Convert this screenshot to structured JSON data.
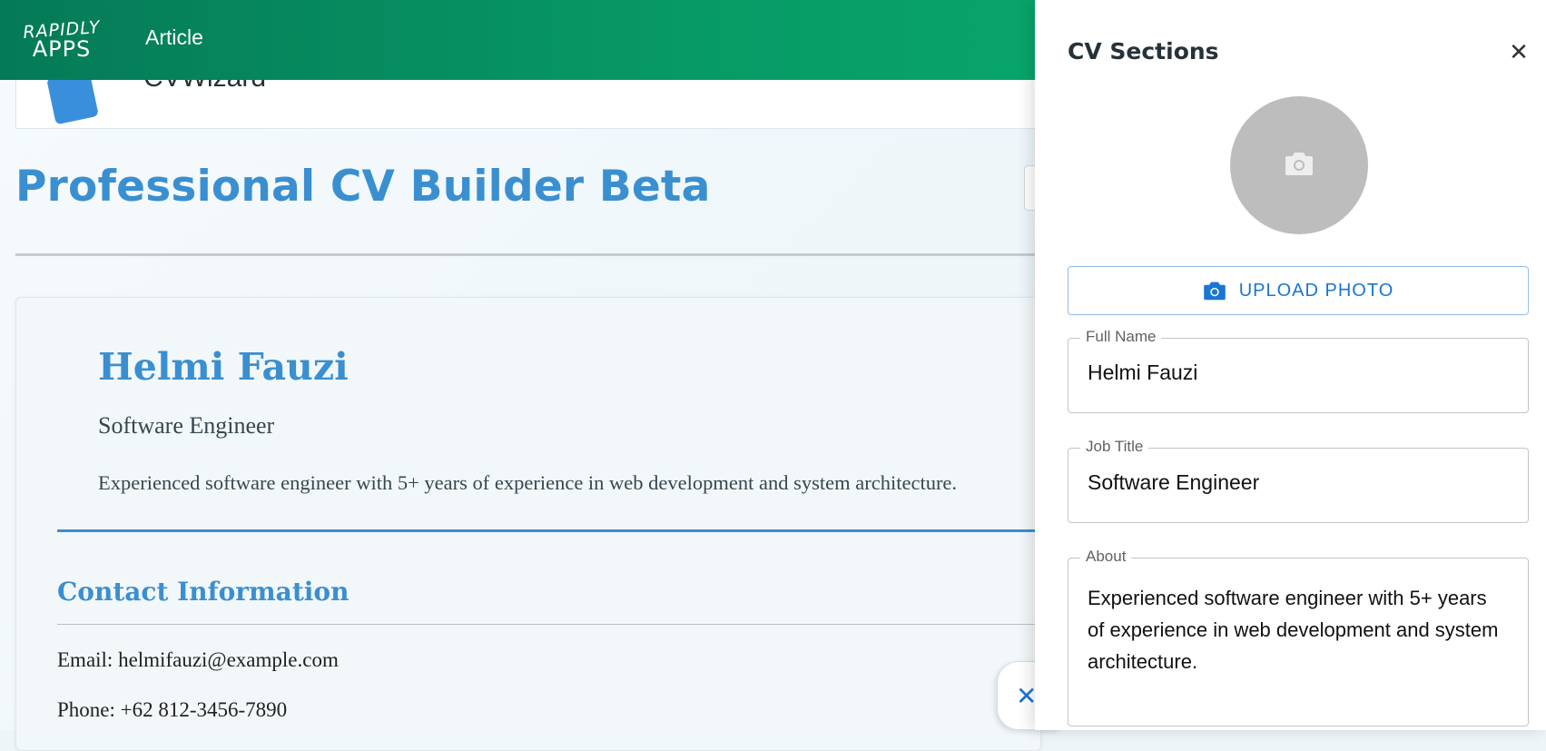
{
  "topbar": {
    "logo_line1": "RAPIDLY",
    "logo_line2": "APPS",
    "nav_article": "Article"
  },
  "header": {
    "app_name": "CVWizard"
  },
  "page": {
    "title": "Professional CV Builder Beta"
  },
  "cv_preview": {
    "name": "Helmi Fauzi",
    "job_title": "Software Engineer",
    "about": "Experienced software engineer with 5+ years of experience in web development and system architecture.",
    "contact_section_title": "Contact Information",
    "email_line": "Email: helmifauzi@example.com",
    "phone_line": "Phone: +62 812-3456-7890",
    "close_fab": "✕"
  },
  "drawer": {
    "title": "CV Sections",
    "close": "✕",
    "upload_label": "UPLOAD PHOTO",
    "fields": {
      "full_name_label": "Full Name",
      "full_name_value": "Helmi Fauzi",
      "job_title_label": "Job Title",
      "job_title_value": "Software Engineer",
      "about_label": "About",
      "about_value": "Experienced software engineer with 5+ years of experience in web development and system architecture."
    }
  },
  "colors": {
    "accent_blue": "#3a8fd0",
    "button_blue": "#1976d2",
    "topbar_green": "#079a66"
  }
}
